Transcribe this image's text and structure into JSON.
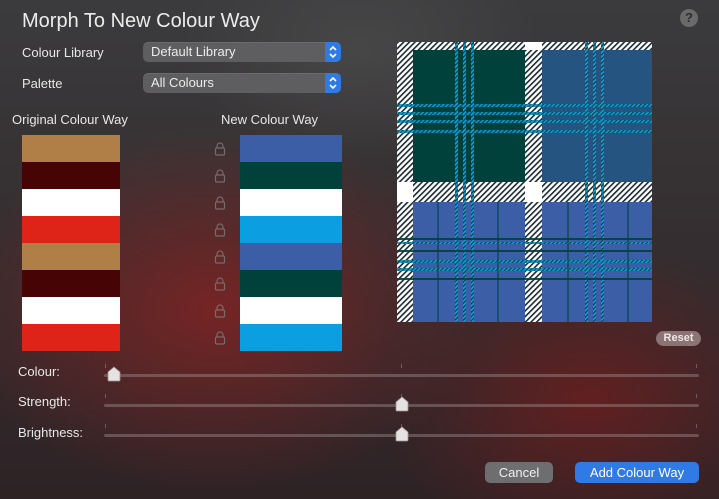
{
  "dialog": {
    "title": "Morph To New Colour Way",
    "help_label": "?"
  },
  "colour_library": {
    "label": "Colour Library",
    "value": "Default Library"
  },
  "palette": {
    "label": "Palette",
    "value": "All Colours"
  },
  "original": {
    "heading": "Original Colour Way",
    "swatches": [
      "#b07f48",
      "#460404",
      "#ffffff",
      "#de2418",
      "#b07f48",
      "#460404",
      "#ffffff",
      "#de2418"
    ]
  },
  "new_colour_way": {
    "heading": "New Colour Way",
    "swatches": [
      "#3b5ea7",
      "#00413b",
      "#ffffff",
      "#0b9ee0",
      "#3b5ea7",
      "#00413b",
      "#ffffff",
      "#0b9ee0"
    ],
    "lock_icons": [
      "lock-icon",
      "lock-icon",
      "lock-icon",
      "lock-icon",
      "lock-icon",
      "lock-icon",
      "lock-icon",
      "lock-icon"
    ]
  },
  "preview": {
    "colours": {
      "green": "#00413b",
      "blue": "#3b5ea7",
      "cyan": "#0b9ee0",
      "white": "#ffffff",
      "dark": "#0a2a2a"
    }
  },
  "reset_label": "Reset",
  "sliders": [
    {
      "label": "Colour:",
      "value": 0.0
    },
    {
      "label": "Strength:",
      "value": 0.5
    },
    {
      "label": "Brightness:",
      "value": 0.5
    }
  ],
  "buttons": {
    "cancel": "Cancel",
    "add": "Add Colour Way"
  },
  "colors": {
    "accent": "#2f7ae5"
  }
}
